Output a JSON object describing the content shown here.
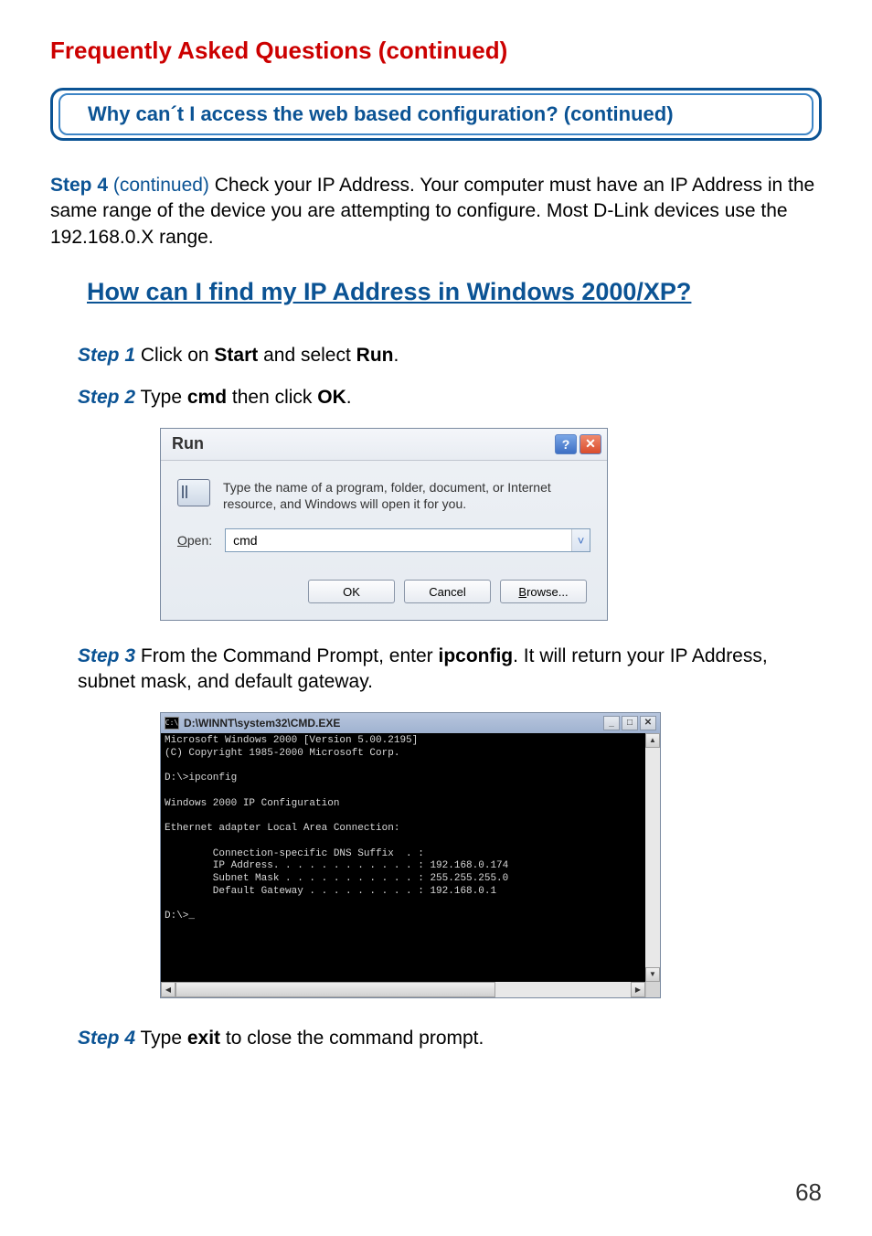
{
  "page_title": "Frequently Asked Questions (continued)",
  "question_banner": "Why can´t I access the web based configuration? (continued)",
  "intro": {
    "step_label": "Step 4",
    "cont": " (continued) ",
    "text": "Check your IP Address. Your computer must have an IP Address in the same range of the device you are attempting to configure. Most D-Link devices use the 192.168.0.X range."
  },
  "section_heading": "How can I find my IP Address in Windows 2000/XP?",
  "step1": {
    "label": "Step 1",
    "pre": " Click on ",
    "b1": "Start",
    "mid": " and select ",
    "b2": "Run",
    "post": "."
  },
  "step2": {
    "label": "Step 2",
    "pre": " Type ",
    "b1": "cmd",
    "mid": " then click ",
    "b2": "OK",
    "post": "."
  },
  "run_dialog": {
    "title": "Run",
    "help_glyph": "?",
    "close_glyph": "✕",
    "description": "Type the name of a program, folder, document, or Internet resource, and Windows will open it for you.",
    "open_label_under": "O",
    "open_label_rest": "pen:",
    "input_value": "cmd",
    "dropdown_glyph": "˅",
    "ok": "OK",
    "cancel": "Cancel",
    "browse_under": "B",
    "browse_rest": "rowse..."
  },
  "step3": {
    "label": "Step 3",
    "pre": " From the Command Prompt, enter ",
    "b1": "ipconfig",
    "post": ". It will return your IP Address, subnet mask, and default gateway."
  },
  "cmd": {
    "icon_glyph": "C:\\",
    "title": "D:\\WINNT\\system32\\CMD.EXE",
    "min_glyph": "_",
    "max_glyph": "□",
    "close_glyph": "✕",
    "scroll_up": "▲",
    "scroll_down": "▼",
    "scroll_left": "◀",
    "scroll_right": "▶",
    "body": "Microsoft Windows 2000 [Version 5.00.2195]\n(C) Copyright 1985-2000 Microsoft Corp.\n\nD:\\>ipconfig\n\nWindows 2000 IP Configuration\n\nEthernet adapter Local Area Connection:\n\n        Connection-specific DNS Suffix  . :\n        IP Address. . . . . . . . . . . . : 192.168.0.174\n        Subnet Mask . . . . . . . . . . . : 255.255.255.0\n        Default Gateway . . . . . . . . . : 192.168.0.1\n\nD:\\>_"
  },
  "step4": {
    "label": "Step 4",
    "pre": " Type ",
    "b1": "exit",
    "post": " to close the command prompt."
  },
  "page_number": "68"
}
